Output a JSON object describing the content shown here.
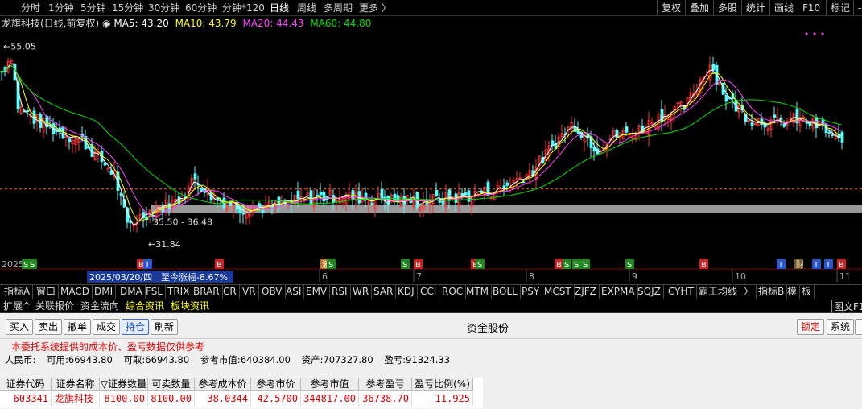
{
  "topbar": {
    "periods": [
      "分时",
      "1分钟",
      "5分钟",
      "15分钟",
      "30分钟",
      "60分钟",
      "分钟*120",
      "日线",
      "周线",
      "多周期",
      "更多 〉"
    ],
    "active_period": "日线",
    "right_buttons": [
      "复权",
      "叠加",
      "多股",
      "统计",
      "画线",
      "F10",
      "标记",
      "-"
    ]
  },
  "legend": {
    "title": "龙旗科技(日线,前复权)",
    "ma5": "MA5: 43.20",
    "ma10": "MA10: 43.79",
    "ma20": "MA20: 44.43",
    "ma60": "MA60: 44.80",
    "colors": {
      "ma5": "#ffffff",
      "ma10": "#ffff00",
      "ma20": "#ff40ff",
      "ma60": "#00e000"
    }
  },
  "chart_data": {
    "type": "candlestick",
    "y_range": [
      31.0,
      56.5
    ],
    "high_label": "55.05",
    "low_label": "31.84",
    "cost_label": "35.50 - 36.48",
    "cost_range": [
      35.5,
      36.48
    ],
    "dashed_level": 38.3,
    "date_info": "2025/03/20/四",
    "change_info": "至今涨幅-8.67%",
    "year_label": "2025年",
    "month_labels": [
      "6",
      "7",
      "8",
      "9",
      "10",
      "11"
    ],
    "mark_icons": [
      "S",
      "S",
      "B",
      "T",
      "B",
      "激",
      "S",
      "S",
      "B",
      "B",
      "S",
      "B",
      "S",
      "S",
      "S",
      "S",
      "B",
      "T",
      "财",
      "T",
      "T",
      "B"
    ]
  },
  "indicators": [
    "指标A",
    "窗口",
    "MACD",
    "DMI",
    "DMA",
    "FSL",
    "TRIX",
    "BRAR",
    "CR",
    "VR",
    "OBV",
    "ASI",
    "EMV",
    "RSI",
    "WR",
    "SAR",
    "KDJ",
    "CCI",
    "ROC",
    "MTM",
    "BOLL",
    "PSY",
    "MCST",
    "ZJFZ",
    "EXPMA",
    "SQJZ",
    "CYHT",
    "霸王均线",
    "〉",
    "指标B",
    "模",
    "板"
  ],
  "subtabs": {
    "items": [
      "扩展^",
      "关联报价",
      "资金流向",
      "综合资讯",
      "板块资讯"
    ],
    "right": "图文F10"
  },
  "trade": {
    "buttons": [
      "买入",
      "卖出",
      "撤单",
      "成交",
      "持仓",
      "刷新"
    ],
    "selected": "持仓",
    "title": "资金股份",
    "right_buttons": [
      "锁定",
      "系统"
    ],
    "notice": "本委托系统提供的成本价、盈亏数据仅供参考",
    "account": {
      "currency": "人民币:",
      "available": "可用:66943.80",
      "withdrawable": "可取:66943.80",
      "market_value": "参考市值:640384.00",
      "assets": "资产:707327.80",
      "pnl": "盈亏:91324.33"
    },
    "table": {
      "headers": [
        "证券代码",
        "证券名称",
        "▽证券数量",
        "可卖数量",
        "参考成本价",
        "参考市价",
        "参考市值",
        "参考盈亏",
        "盈亏比例(%)"
      ],
      "rows": [
        [
          "603341",
          "龙旗科技",
          "8100.00",
          "8100.00",
          "38.0344",
          "42.5700",
          "344817.00",
          "36738.70",
          "11.925"
        ]
      ]
    }
  }
}
